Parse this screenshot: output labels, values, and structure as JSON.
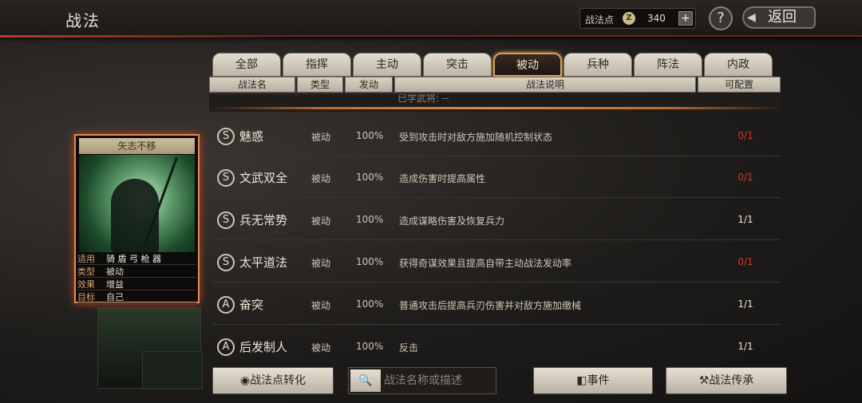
{
  "header": {
    "title": "战法"
  },
  "points": {
    "label": "战法点",
    "coin_icon": "Z",
    "value": "340",
    "plus": "+"
  },
  "help": {
    "label": "?"
  },
  "back": {
    "label": "返回",
    "arrow": "◀"
  },
  "tabs": [
    {
      "label": "全部"
    },
    {
      "label": "指挥"
    },
    {
      "label": "主动"
    },
    {
      "label": "突击"
    },
    {
      "label": "被动",
      "active": true
    },
    {
      "label": "兵种"
    },
    {
      "label": "阵法"
    },
    {
      "label": "内政"
    }
  ],
  "columns": [
    "战法名",
    "类型",
    "发动",
    "战法说明",
    "可配置"
  ],
  "list_header": "已学武将:  --",
  "rows": [
    {
      "rank": "S",
      "name": "魅惑",
      "type": "被动",
      "pct": "100%",
      "desc": "受到攻击时对敌方施加随机控制状态",
      "cfg": "0/1",
      "red": true
    },
    {
      "rank": "S",
      "name": "文武双全",
      "type": "被动",
      "pct": "100%",
      "desc": "造成伤害时提高属性",
      "cfg": "0/1",
      "red": true
    },
    {
      "rank": "S",
      "name": "兵无常势",
      "type": "被动",
      "pct": "100%",
      "desc": "造成谋略伤害及恢复兵力",
      "cfg": "1/1",
      "red": false
    },
    {
      "rank": "S",
      "name": "太平道法",
      "type": "被动",
      "pct": "100%",
      "desc": "获得奇谋效果且提高自带主动战法发动率",
      "cfg": "0/1",
      "red": true
    },
    {
      "rank": "A",
      "name": "奋突",
      "type": "被动",
      "pct": "100%",
      "desc": "普通攻击后提高兵刃伤害并对敌方施加缴械",
      "cfg": "1/1",
      "red": false
    },
    {
      "rank": "A",
      "name": "后发制人",
      "type": "被动",
      "pct": "100%",
      "desc": "反击",
      "cfg": "1/1",
      "red": false
    }
  ],
  "card": {
    "title": "矢志不移",
    "info": [
      {
        "k": "适用",
        "v": "骑 盾 弓 枪 器"
      },
      {
        "k": "类型",
        "v": "被动"
      },
      {
        "k": "效果",
        "v": "增益"
      },
      {
        "k": "目标",
        "v": "自己"
      }
    ]
  },
  "buttons": {
    "convert": "战法点转化",
    "event": "事件",
    "inherit": "战法传承"
  },
  "search": {
    "placeholder": "战法名称或描述",
    "icon": "🔍"
  }
}
